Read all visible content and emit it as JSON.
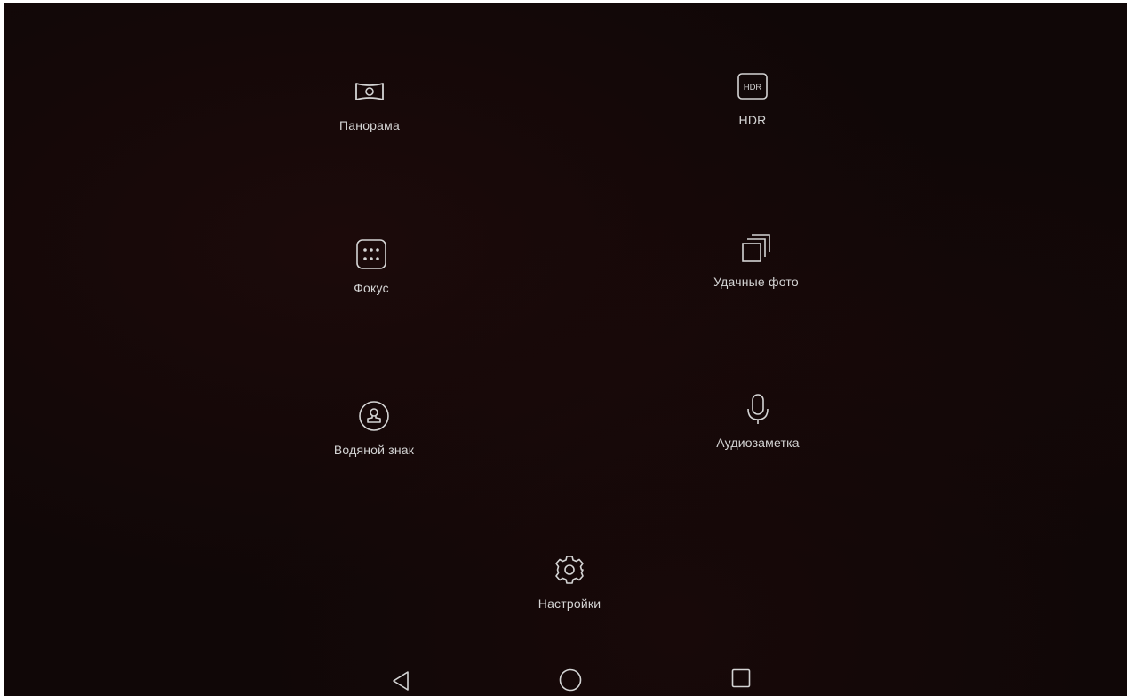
{
  "modes": {
    "panorama": {
      "label": "Панорама",
      "icon": "panorama-icon"
    },
    "hdr": {
      "label": "HDR",
      "icon": "hdr-icon",
      "icon_text": "HDR"
    },
    "focus": {
      "label": "Фокус",
      "icon": "focus-icon"
    },
    "good_food": {
      "label": "Удачные фото",
      "icon": "stacked-photos-icon"
    },
    "watermark": {
      "label": "Водяной знак",
      "icon": "watermark-icon"
    },
    "audio_note": {
      "label": "Аудиозаметка",
      "icon": "microphone-icon"
    },
    "settings": {
      "label": "Настройки",
      "icon": "gear-icon"
    }
  },
  "navbar": {
    "back": "back-triangle-icon",
    "home": "home-circle-icon",
    "recents": "recents-square-icon"
  },
  "colors": {
    "background": "#100707",
    "foreground": "#d4d4d4"
  }
}
